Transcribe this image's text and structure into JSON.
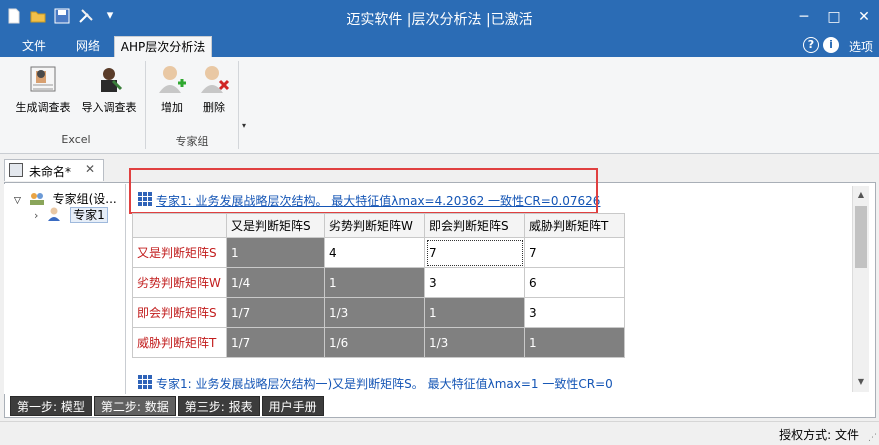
{
  "window": {
    "title": "迈实软件 |层次分析法 |已激活",
    "minimize": "─",
    "maximize": "□",
    "close": "✕"
  },
  "qat": {
    "new_icon": "new-file-icon",
    "open_icon": "open-folder-icon",
    "save_icon": "save-icon",
    "tools_icon": "tools-icon",
    "dropdown": "▾"
  },
  "ribbon_tabs": [
    {
      "label": "文件"
    },
    {
      "label": "网络"
    },
    {
      "label": "AHP层次分析法"
    }
  ],
  "ribbon_right": {
    "help": "?",
    "info": "i",
    "options": "选项"
  },
  "ribbon": {
    "buttons": [
      {
        "label": "生成调查表"
      },
      {
        "label": "导入调查表"
      },
      {
        "label": "增加"
      },
      {
        "label": "删除"
      }
    ],
    "groups": [
      {
        "label": "Excel"
      },
      {
        "label": "专家组"
      }
    ],
    "collapse": "▾"
  },
  "doc_tab": {
    "label": "未命名*",
    "close": "✕"
  },
  "tree": {
    "root": {
      "toggle": "▽",
      "label": "专家组(设..."
    },
    "child": {
      "toggle": "›",
      "label": "专家1"
    }
  },
  "header_link": "专家1: 业务发展战略层次结构。 最大特征值λmax=4.20362 一致性CR=0.07626",
  "matrix": {
    "columns": [
      "又是判断矩阵S",
      "劣势判断矩阵W",
      "即会判断矩阵S",
      "威胁判断矩阵T"
    ],
    "rows": [
      {
        "label": "又是判断矩阵S",
        "cells": [
          "1",
          "4",
          "7",
          "7"
        ]
      },
      {
        "label": "劣势判断矩阵W",
        "cells": [
          "1/4",
          "1",
          "3",
          "6"
        ]
      },
      {
        "label": "即会判断矩阵S",
        "cells": [
          "1/7",
          "1/3",
          "1",
          "3"
        ]
      },
      {
        "label": "威胁判断矩阵T",
        "cells": [
          "1/7",
          "1/6",
          "1/3",
          "1"
        ]
      }
    ]
  },
  "footer_link": "专家1: 业务发展战略层次结构一)又是判断矩阵S。 最大特征值λmax=1 一致性CR=0",
  "scroll": {
    "up": "▲",
    "down": "▼"
  },
  "steps": [
    {
      "label": "第一步: 模型"
    },
    {
      "label": "第二步: 数据"
    },
    {
      "label": "第三步: 报表"
    },
    {
      "label": "用户手册"
    }
  ],
  "status": {
    "text": "授权方式:  文件",
    "grip": "⋰"
  }
}
